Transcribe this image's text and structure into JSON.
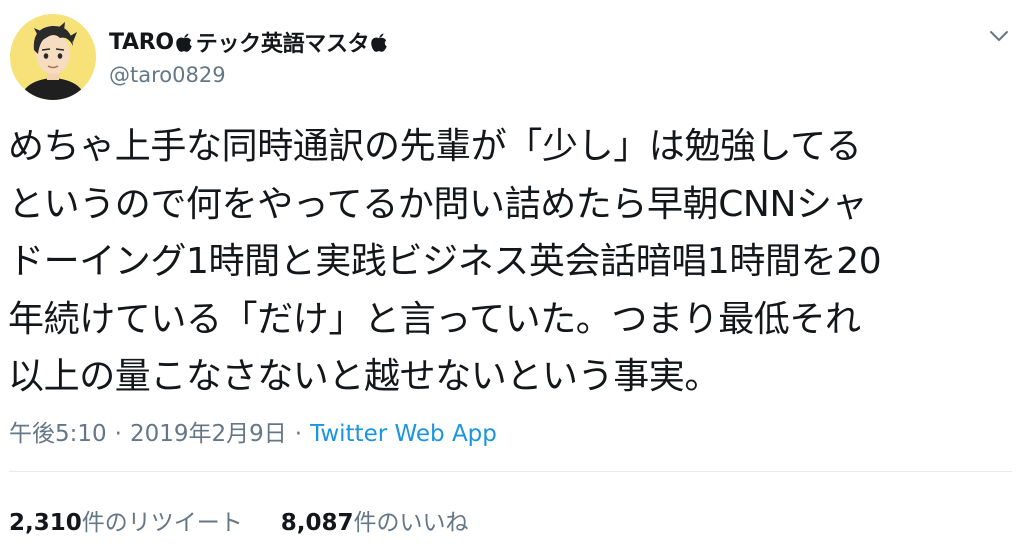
{
  "tweet": {
    "display_name_part1": "TARO",
    "display_name_part2": "テック英語マスタ",
    "handle": "@taro0829",
    "text": "めちゃ上手な同時通訳の先輩が「少し」は勉強してる\nというので何をやってるか問い詰めたら早朝CNNシャ\nドーイング1時間と実践ビジネス英会話暗唱1時間を20\n年続けている「だけ」と言っていた。つまり最低それ\n以上の量こなさないと越せないという事実。",
    "time": "午後5:10",
    "separator": "·",
    "date": "2019年2月9日",
    "source": "Twitter Web App",
    "retweets_count": "2,310",
    "retweets_label": "件のリツイート",
    "likes_count": "8,087",
    "likes_label": "件のいいね"
  },
  "icons": {
    "avatar": "avatar-illustration",
    "name_emoji": "apple-logo-icon",
    "menu": "chevron-down-icon"
  },
  "colors": {
    "text": "#14171a",
    "secondary": "#657786",
    "link": "#1b95e0",
    "divider": "#e6ecf0",
    "avatar_bg": "#f7e27a"
  }
}
